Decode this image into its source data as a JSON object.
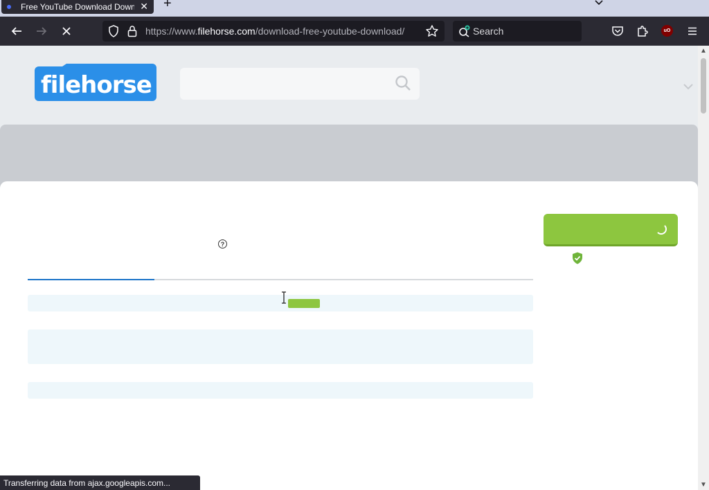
{
  "browser": {
    "tab": {
      "title": "Free YouTube Download Downl",
      "close": "✕"
    },
    "new_tab": "+",
    "url": {
      "prefix": "https://www.",
      "domain": "filehorse.com",
      "path": "/download-free-youtube-download/"
    },
    "search": {
      "placeholder": "Search"
    },
    "ublock_badge": "uO",
    "status_text": "Transferring data from ajax.googleapis.com..."
  },
  "site": {
    "logo_text": "filehorse",
    "help_glyph": "?",
    "brand_colors": {
      "green": "#8dc63f",
      "blue": "#2b8fe8",
      "tab_active": "#1a73c8"
    }
  },
  "icons": {
    "back": "arrow-left-icon",
    "forward": "arrow-right-icon",
    "stop": "close-icon",
    "shield": "shield-icon",
    "lock": "lock-icon",
    "star": "star-icon",
    "pocket": "pocket-icon",
    "extensions": "puzzle-icon",
    "menu": "hamburger-icon",
    "search": "search-icon",
    "chevron": "chevron-down-icon",
    "verified": "shield-check-icon"
  }
}
